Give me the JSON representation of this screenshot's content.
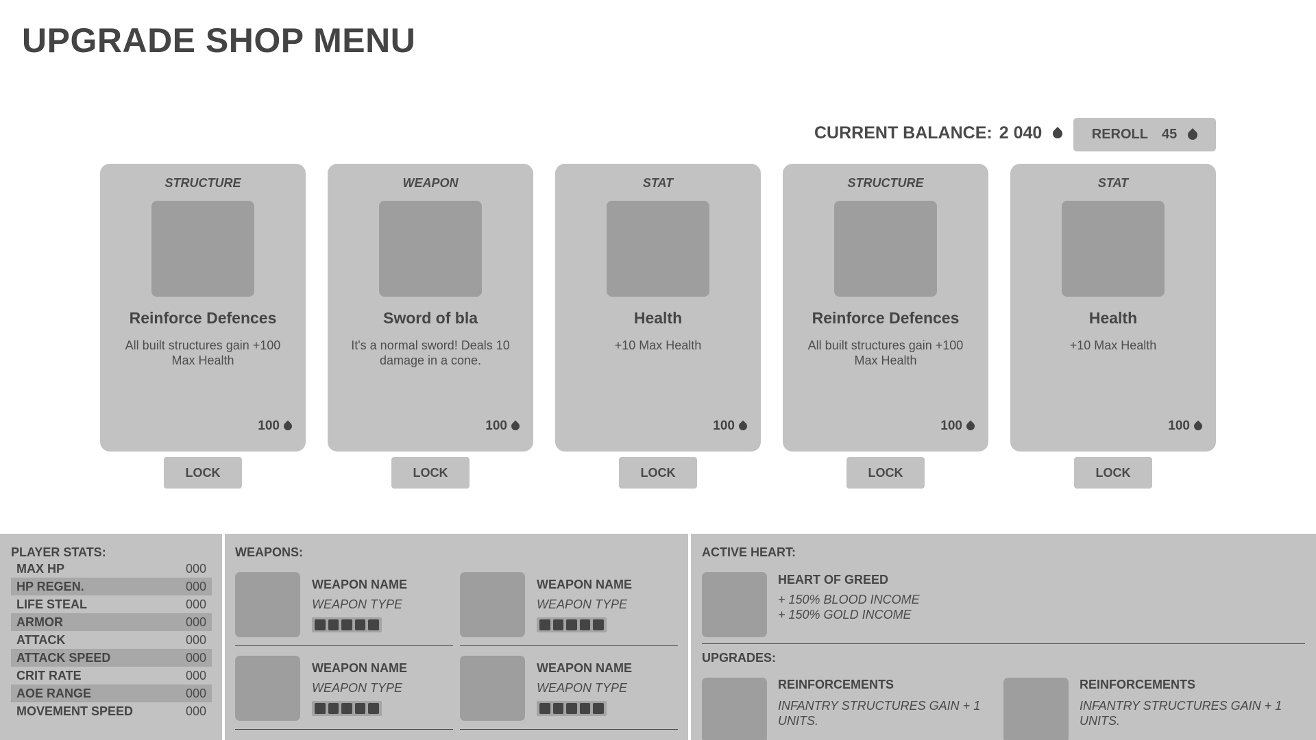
{
  "title": "UPGRADE SHOP MENU",
  "balance": {
    "label": "CURRENT BALANCE:",
    "value": "2 040",
    "currency_icon": "blood-drop-icon"
  },
  "reroll": {
    "label": "REROLL",
    "cost": "45"
  },
  "cards": [
    {
      "type": "STRUCTURE",
      "name": "Reinforce Defences",
      "desc": "All built structures gain +100 Max Health",
      "cost": "100",
      "lock_label": "LOCK"
    },
    {
      "type": "WEAPON",
      "name": "Sword of bla",
      "desc": "It's a normal sword! Deals 10 damage in a cone.",
      "cost": "100",
      "lock_label": "LOCK"
    },
    {
      "type": "STAT",
      "name": "Health",
      "desc": "+10 Max Health",
      "cost": "100",
      "lock_label": "LOCK"
    },
    {
      "type": "STRUCTURE",
      "name": "Reinforce Defences",
      "desc": "All built structures gain +100 Max Health",
      "cost": "100",
      "lock_label": "LOCK"
    },
    {
      "type": "STAT",
      "name": "Health",
      "desc": "+10 Max Health",
      "cost": "100",
      "lock_label": "LOCK"
    }
  ],
  "player_stats": {
    "title": "PLAYER STATS:",
    "rows": [
      {
        "label": "MAX HP",
        "value": "000"
      },
      {
        "label": "HP REGEN.",
        "value": "000"
      },
      {
        "label": "LIFE STEAL",
        "value": "000"
      },
      {
        "label": "ARMOR",
        "value": "000"
      },
      {
        "label": "ATTACK",
        "value": "000"
      },
      {
        "label": "ATTACK SPEED",
        "value": "000"
      },
      {
        "label": "CRIT RATE",
        "value": "000"
      },
      {
        "label": "AOE RANGE",
        "value": "000"
      },
      {
        "label": "MOVEMENT SPEED",
        "value": "000"
      }
    ]
  },
  "weapons": {
    "title": "WEAPONS:",
    "slots": [
      {
        "name": "WEAPON NAME",
        "type": "WEAPON TYPE",
        "level_pips": 5
      },
      {
        "name": "WEAPON NAME",
        "type": "WEAPON TYPE",
        "level_pips": 5
      },
      {
        "name": "WEAPON NAME",
        "type": "WEAPON TYPE",
        "level_pips": 5
      },
      {
        "name": "WEAPON NAME",
        "type": "WEAPON TYPE",
        "level_pips": 5
      }
    ]
  },
  "active_heart": {
    "title": "ACTIVE HEART:",
    "name": "HEART OF GREED",
    "effects": [
      "+ 150% BLOOD INCOME",
      "+ 150% GOLD INCOME"
    ]
  },
  "upgrades": {
    "title": "UPGRADES:",
    "items": [
      {
        "name": "REINFORCEMENTS",
        "desc": "INFANTRY STRUCTURES GAIN + 1 UNITS."
      },
      {
        "name": "REINFORCEMENTS",
        "desc": "INFANTRY STRUCTURES GAIN + 1 UNITS."
      }
    ]
  }
}
